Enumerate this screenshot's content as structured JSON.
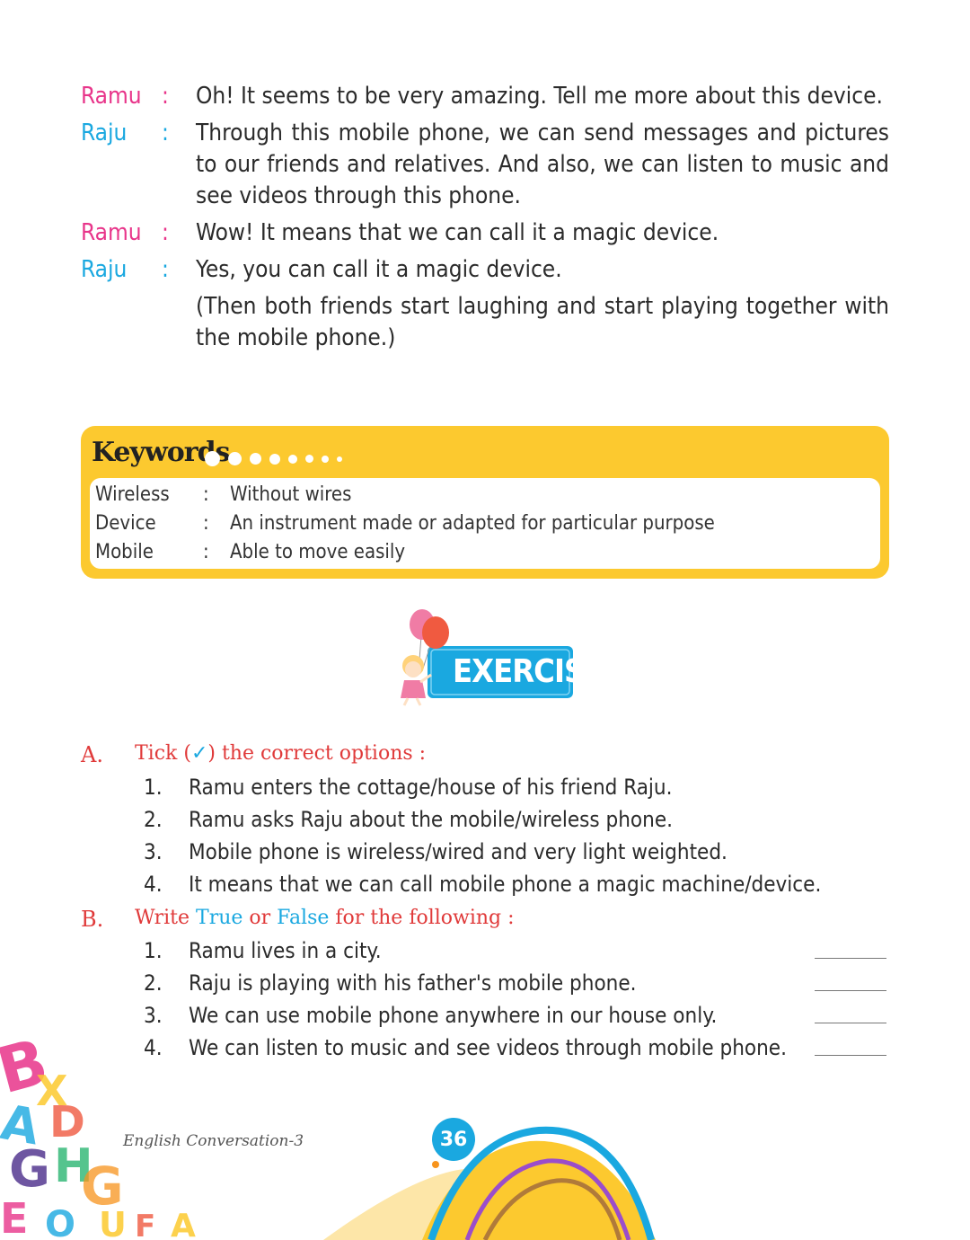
{
  "dialogue": [
    {
      "speaker": "Ramu",
      "colon": ":",
      "text": "Oh! It seems to be very amazing. Tell me more about this device."
    },
    {
      "speaker": "Raju",
      "colon": ":",
      "text": "Through this mobile phone, we can send messages and pictures to our friends and relatives. And also, we can listen to music and see videos through this phone."
    },
    {
      "speaker": "Ramu",
      "colon": ":",
      "text": "Wow! It means that we can call it a magic device."
    },
    {
      "speaker": "Raju",
      "colon": ":",
      "text": "Yes, you can call it a magic device."
    },
    {
      "speaker": "",
      "colon": "",
      "text": "(Then both friends start laughing and start playing together with the mobile phone.)"
    }
  ],
  "keywords": {
    "title": "Keywords",
    "items": [
      {
        "term": "Wireless",
        "colon": ":",
        "definition": "Without wires"
      },
      {
        "term": "Device",
        "colon": ":",
        "definition": "An instrument made or adapted for particular purpose"
      },
      {
        "term": "Mobile",
        "colon": ":",
        "definition": "Able to move easily"
      }
    ]
  },
  "exercise": {
    "banner": "EXERCISE"
  },
  "section_a": {
    "label": "A.",
    "title_pre": "Tick (",
    "tick": "✓",
    "title_post": ") the correct options :",
    "items": [
      {
        "num": "1.",
        "text": "Ramu enters the cottage/house of his friend Raju."
      },
      {
        "num": "2.",
        "text": "Ramu asks Raju about the mobile/wireless phone."
      },
      {
        "num": "3.",
        "text": "Mobile phone is wireless/wired and very light weighted."
      },
      {
        "num": "4.",
        "text": "It means that we can call mobile phone a magic machine/device."
      }
    ]
  },
  "section_b": {
    "label": "B.",
    "title_write": "Write ",
    "title_true": "True",
    "title_or": " or ",
    "title_false": "False",
    "title_post": " for the following :",
    "items": [
      {
        "num": "1.",
        "text": "Ramu lives in a city."
      },
      {
        "num": "2.",
        "text": "Raju is playing with his father's mobile phone."
      },
      {
        "num": "3.",
        "text": "We can use mobile phone anywhere in our house only."
      },
      {
        "num": "4.",
        "text": "We can listen to music and see videos through mobile phone."
      }
    ]
  },
  "footer": {
    "book_title": "English Conversation-3",
    "page_number": "36"
  },
  "colors": {
    "ramu": "#e8358a",
    "raju": "#1aa8e0",
    "keywords_bg": "#fcc92f",
    "heading_red": "#e03a3a",
    "accent_blue": "#1aa8e0"
  }
}
